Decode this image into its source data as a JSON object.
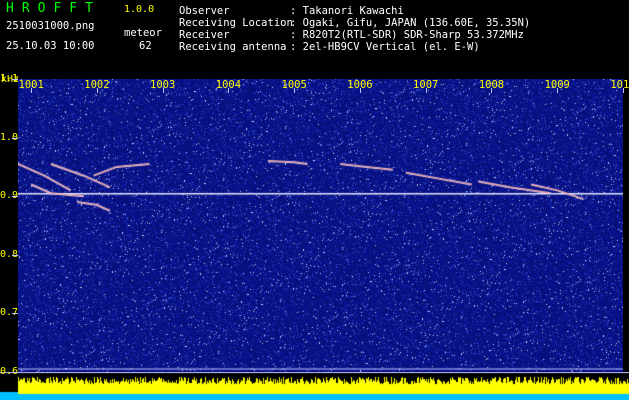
{
  "header": {
    "logo": "HROFFT",
    "version": "1.0.0",
    "filename": "2510031000.png",
    "datetime": "25.10.03 10:00",
    "meteor_label": "meteor",
    "meteor_count": "62",
    "fields": [
      {
        "label": "Observer",
        "value": ": Takanori Kawachi"
      },
      {
        "label": "Receiving Location",
        "value": ": Ogaki, Gifu, JAPAN (136.60E, 35.35N)"
      },
      {
        "label": "Receiver",
        "value": ": R820T2(RTL-SDR) SDR-Sharp 53.372MHz"
      },
      {
        "label": "Receiving antenna",
        "value": ": 2el-HB9CV Vertical (el. E-W)"
      }
    ]
  },
  "colors": {
    "background": "#000000",
    "plot_noise": "#0c1890",
    "text_header": "#ffffff",
    "text_axis": "#ffff00",
    "logo": "#00ff00",
    "echo": "#ffffff",
    "bar_fill": "#ffff00",
    "bar_base": "#00c0ff"
  },
  "chart_data": {
    "type": "heatmap",
    "unit_label": "kHz",
    "x_ticks": [
      "1001",
      "1002",
      "1003",
      "1004",
      "1005",
      "1006",
      "1007",
      "1008",
      "1009",
      "1010"
    ],
    "y_ticks": [
      "1.1",
      "1.0",
      "0.9",
      "0.8",
      "0.7",
      "0.6"
    ],
    "y_range": [
      0.6,
      1.1
    ],
    "x_range": [
      1000.8,
      1010.0
    ],
    "carrier_khz": 0.904,
    "echoes": [
      {
        "x": [
          1000.8,
          1001.2,
          1001.6
        ],
        "y": [
          0.955,
          0.935,
          0.91
        ]
      },
      {
        "x": [
          1001.0,
          1001.3,
          1001.8
        ],
        "y": [
          0.92,
          0.905,
          0.9
        ]
      },
      {
        "x": [
          1001.3,
          1001.8,
          1002.2
        ],
        "y": [
          0.955,
          0.935,
          0.915
        ]
      },
      {
        "x": [
          1001.7,
          1002.0,
          1002.2
        ],
        "y": [
          0.89,
          0.885,
          0.875
        ]
      },
      {
        "x": [
          1001.95,
          1002.3,
          1002.8
        ],
        "y": [
          0.935,
          0.95,
          0.955
        ]
      },
      {
        "x": [
          1004.6,
          1005.0,
          1005.2
        ],
        "y": [
          0.96,
          0.958,
          0.955
        ]
      },
      {
        "x": [
          1005.7,
          1006.1,
          1006.5
        ],
        "y": [
          0.955,
          0.95,
          0.945
        ]
      },
      {
        "x": [
          1006.7,
          1007.2,
          1007.7
        ],
        "y": [
          0.94,
          0.93,
          0.92
        ]
      },
      {
        "x": [
          1007.8,
          1008.3,
          1008.9
        ],
        "y": [
          0.925,
          0.915,
          0.905
        ]
      },
      {
        "x": [
          1008.6,
          1009.0,
          1009.4
        ],
        "y": [
          0.92,
          0.91,
          0.895
        ]
      }
    ]
  }
}
